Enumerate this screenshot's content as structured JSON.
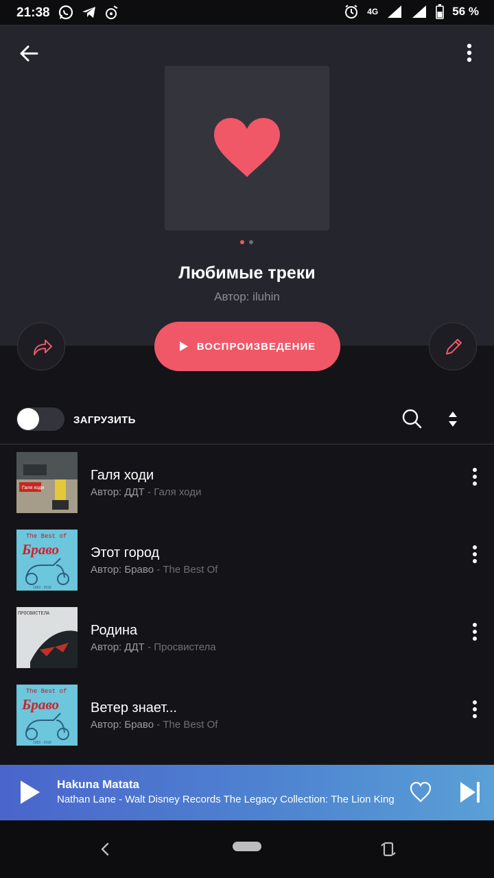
{
  "status_bar": {
    "time": "21:38",
    "network": "4G",
    "battery": "56 %"
  },
  "header": {
    "cover_icon": "heart-icon",
    "pager_dots": [
      "active",
      "inactive"
    ],
    "title": "Любимые треки",
    "author": "Автор: iluhin"
  },
  "actions": {
    "share_icon": "share-icon",
    "play_label": "ВОСПРОИЗВЕДЕНИЕ",
    "edit_icon": "pencil-icon"
  },
  "controls": {
    "download_label": "ЗАГРУЗИТЬ",
    "download_enabled": false,
    "search_icon": "search-icon",
    "sort_icon": "sort-icon"
  },
  "tracks": [
    {
      "title": "Галя ходи",
      "artist": "Автор: ДДТ",
      "album": " - Галя ходи"
    },
    {
      "title": "Этот город",
      "artist": "Автор: Браво",
      "album": " - The Best Of"
    },
    {
      "title": "Родина",
      "artist": "Автор: ДДТ",
      "album": " - Просвистела"
    },
    {
      "title": "Ветер знает...",
      "artist": "Автор: Браво",
      "album": " - The Best Of"
    }
  ],
  "album_art_text": {
    "bravo_top": "The Best of",
    "bravo_logo": "Браво",
    "bravo_years": "1983 · 2018",
    "ddt_top": "ПРОСВИСТЕЛА",
    "galya_label": "Галя ходи"
  },
  "now_playing": {
    "song": "Hakuna Matata",
    "artist": "Nathan Lane - Walt Disney Records The Legacy Collection: The Lion King"
  },
  "colors": {
    "accent": "#f05868",
    "header_bg": "#25252d",
    "list_bg": "#141418"
  }
}
